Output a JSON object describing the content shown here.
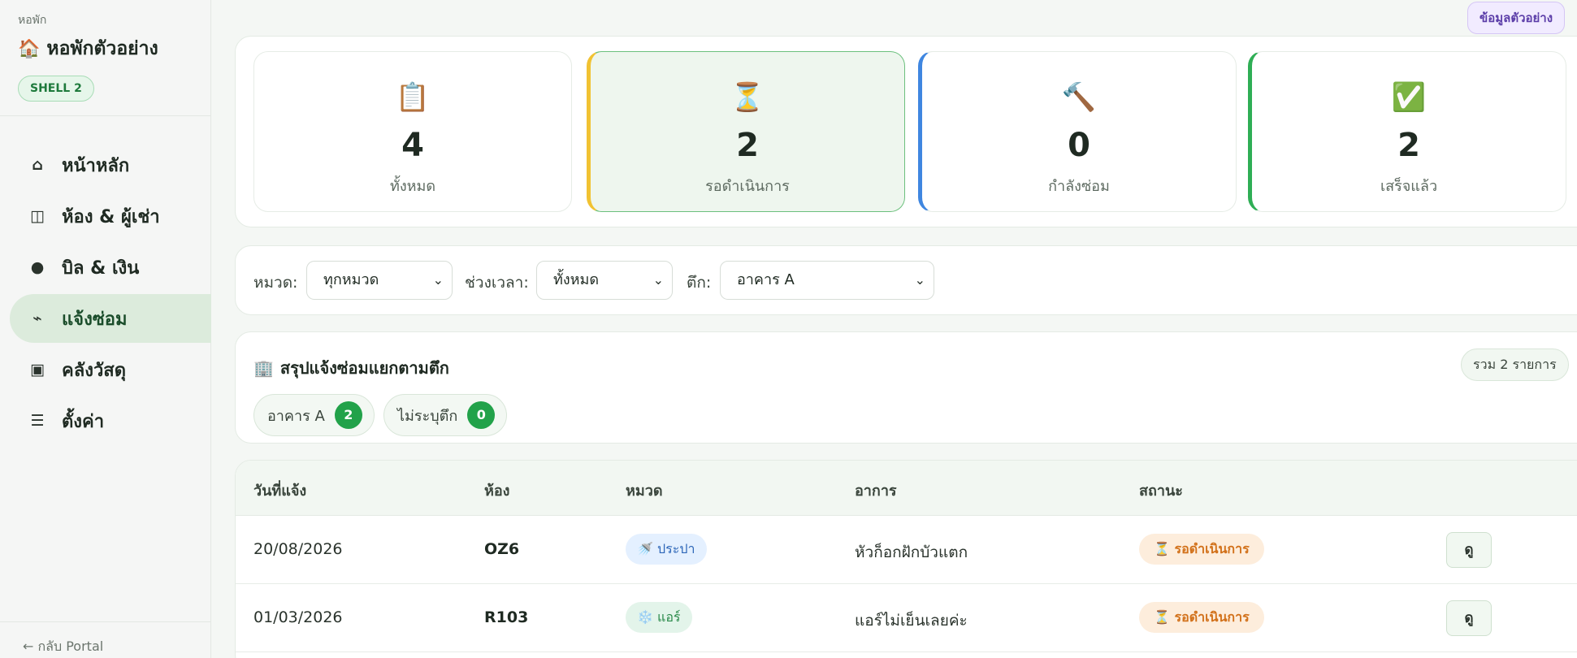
{
  "sidebar": {
    "brand_small": "หอพัก",
    "brand_icon": "🏠",
    "brand_title": "หอพักตัวอย่าง",
    "shell_badge": "SHELL 2",
    "items": [
      {
        "icon": "⌂",
        "label": "หน้าหลัก",
        "icon_name": "home-icon"
      },
      {
        "icon": "◫",
        "label": "ห้อง & ผู้เช่า",
        "icon_name": "rooms-icon"
      },
      {
        "icon": "●",
        "label": "บิล & เงิน",
        "icon_name": "billing-icon"
      },
      {
        "icon": "⌁",
        "label": "แจ้งซ่อม",
        "icon_name": "repair-icon",
        "active": true
      },
      {
        "icon": "▣",
        "label": "คลังวัสดุ",
        "icon_name": "inventory-icon"
      },
      {
        "icon": "☰",
        "label": "ตั้งค่า",
        "icon_name": "settings-icon"
      }
    ],
    "back_link": "← กลับ Portal"
  },
  "header": {
    "demo_button": "ข้อมูลตัวอย่าง"
  },
  "stats": [
    {
      "icon": "📋",
      "value": "4",
      "label": "ทั้งหมด"
    },
    {
      "icon": "⏳",
      "value": "2",
      "label": "รอดำเนินการ"
    },
    {
      "icon": "🔨",
      "value": "0",
      "label": "กำลังซ่อม"
    },
    {
      "icon": "✅",
      "value": "2",
      "label": "เสร็จแล้ว"
    }
  ],
  "filters": {
    "category_label": "หมวด:",
    "category_value": "ทุกหมวด",
    "period_label": "ช่วงเวลา:",
    "period_value": "ทั้งหมด",
    "building_label": "ตึก:",
    "building_value": "อาคาร A"
  },
  "summary": {
    "icon": "🏢",
    "title": "สรุปแจ้งซ่อมแยกตามตึก",
    "total": "รวม 2 รายการ",
    "chips": [
      {
        "label": "อาคาร A",
        "count": "2"
      },
      {
        "label": "ไม่ระบุตึก",
        "count": "0"
      }
    ]
  },
  "table": {
    "headers": [
      "วันที่แจ้ง",
      "ห้อง",
      "หมวด",
      "อาการ",
      "สถานะ"
    ],
    "rows": [
      {
        "date": "20/08/2026",
        "room": "OZ6",
        "category": "🚿 ประปา",
        "symptom": "หัวก็อกฝักบัวแตก",
        "status": "⏳ รอดำเนินการ",
        "action": "ดู"
      },
      {
        "date": "01/03/2026",
        "room": "R103",
        "category": "❄️ แอร์",
        "symptom": "แอร์ไม่เย็นเลยค่ะ",
        "status": "⏳ รอดำเนินการ",
        "action": "ดู"
      }
    ]
  }
}
